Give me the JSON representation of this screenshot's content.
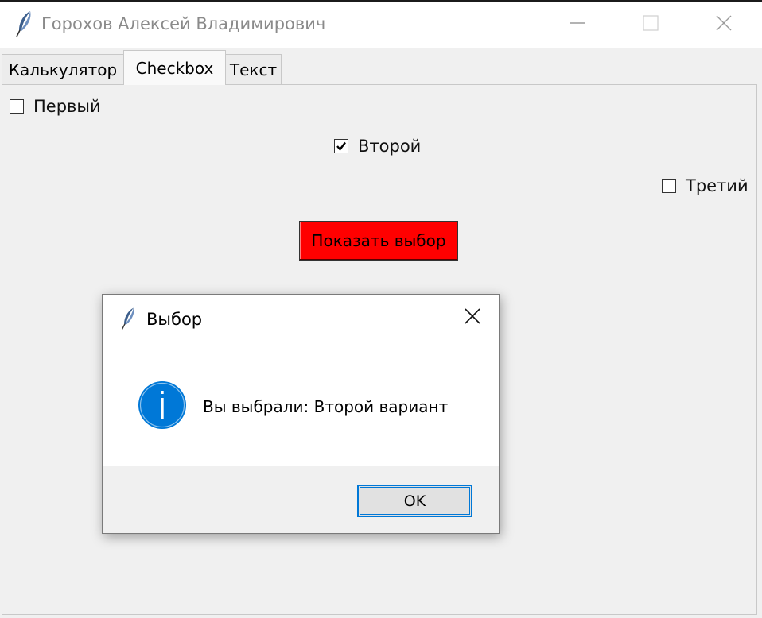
{
  "window": {
    "title": "Горохов Алексей Владимирович",
    "icon": "feather-icon",
    "controls": {
      "minimize": "minimize-icon",
      "maximize": "maximize-icon",
      "close": "close-icon"
    }
  },
  "tabs": [
    {
      "label": "Калькулятор",
      "active": false
    },
    {
      "label": "Checkbox",
      "active": true
    },
    {
      "label": "Текст",
      "active": false
    }
  ],
  "checkboxes": [
    {
      "label": "Первый",
      "checked": false
    },
    {
      "label": "Второй",
      "checked": true
    },
    {
      "label": "Третий",
      "checked": false
    }
  ],
  "show_button": {
    "label": "Показать выбор",
    "color": "#ff0000"
  },
  "dialog": {
    "title": "Выбор",
    "icon": "info-icon",
    "message": "Вы выбрали: Второй вариант",
    "ok_label": "OK",
    "accent": "#0078d7"
  }
}
